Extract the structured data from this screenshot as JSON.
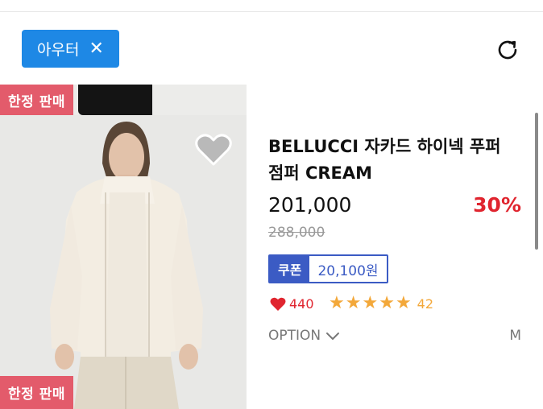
{
  "filter": {
    "chip_label": "아우터",
    "close_glyph": "✕"
  },
  "badges": {
    "limited_sale": "한정 판매"
  },
  "product": {
    "title": "BELLUCCI 자카드 하이넥 푸퍼 점퍼 CREAM",
    "price": "201,000",
    "discount": "30%",
    "original_price": "288,000",
    "coupon_label": "쿠폰",
    "coupon_price": "20,100원",
    "likes": "440",
    "rating_stars": 5,
    "review_count": "42",
    "option_label": "OPTION",
    "size": "M"
  },
  "colors": {
    "chip": "#1e88e5",
    "badge": "#e35b6b",
    "discount": "#e0252f",
    "coupon": "#3b5bc4",
    "stars": "#f3a83a"
  },
  "icons": {
    "refresh": "refresh-icon",
    "wish": "heart-outline-icon",
    "like": "heart-icon",
    "option": "chevron-down-icon"
  }
}
